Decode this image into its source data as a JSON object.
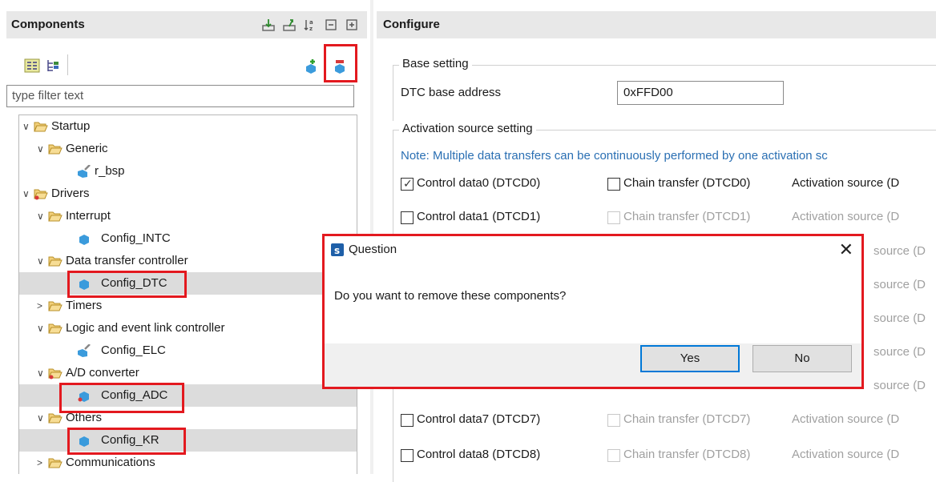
{
  "components_panel": {
    "title": "Components",
    "filter_placeholder": "type filter text",
    "tree": [
      {
        "label": "Startup",
        "arrow": "∨"
      },
      {
        "label": "Generic",
        "arrow": "∨"
      },
      {
        "label": "r_bsp",
        "arrow": ""
      },
      {
        "label": "Drivers",
        "arrow": "∨"
      },
      {
        "label": "Interrupt",
        "arrow": "∨"
      },
      {
        "label": "Config_INTC",
        "arrow": ""
      },
      {
        "label": "Data transfer controller",
        "arrow": "∨"
      },
      {
        "label": "Config_DTC",
        "arrow": ""
      },
      {
        "label": "Timers",
        "arrow": ">"
      },
      {
        "label": "Logic and event link controller",
        "arrow": "∨"
      },
      {
        "label": "Config_ELC",
        "arrow": ""
      },
      {
        "label": "A/D converter",
        "arrow": "∨"
      },
      {
        "label": "Config_ADC",
        "arrow": ""
      },
      {
        "label": "Others",
        "arrow": "∨"
      },
      {
        "label": "Config_KR",
        "arrow": ""
      },
      {
        "label": "Communications",
        "arrow": ">"
      }
    ]
  },
  "configure_panel": {
    "title": "Configure",
    "base_setting": {
      "legend": "Base setting",
      "address_label": "DTC base address",
      "address_value": "0xFFD00"
    },
    "activation": {
      "legend": "Activation source setting",
      "note": "Note: Multiple data transfers can be continuously performed by one activation sc",
      "rows": [
        {
          "control": "Control data0 (DTCD0)",
          "chain": "Chain transfer (DTCD0)",
          "source": "Activation source (D"
        },
        {
          "control": "Control data1 (DTCD1)",
          "chain": "Chain transfer (DTCD1)",
          "source": "Activation source (D"
        },
        {
          "source": "source (D"
        },
        {
          "source": "source (D"
        },
        {
          "source": "source (D"
        },
        {
          "source": "source (D"
        },
        {
          "source": "source (D"
        },
        {
          "control": "Control data7 (DTCD7)",
          "chain": "Chain transfer (DTCD7)",
          "source": "Activation source (D"
        },
        {
          "control": "Control data8 (DTCD8)",
          "chain": "Chain transfer (DTCD8)",
          "source": "Activation source (D"
        }
      ]
    }
  },
  "dialog": {
    "title": "Question",
    "message": "Do you want to remove these components?",
    "yes_label": "Yes",
    "no_label": "No",
    "close_glyph": "✕"
  },
  "colors": {
    "highlight_red": "#e3191f",
    "selection_gray": "#dcdcdc",
    "note_blue": "#2a6fb3",
    "default_button_blue": "#0078d7"
  }
}
